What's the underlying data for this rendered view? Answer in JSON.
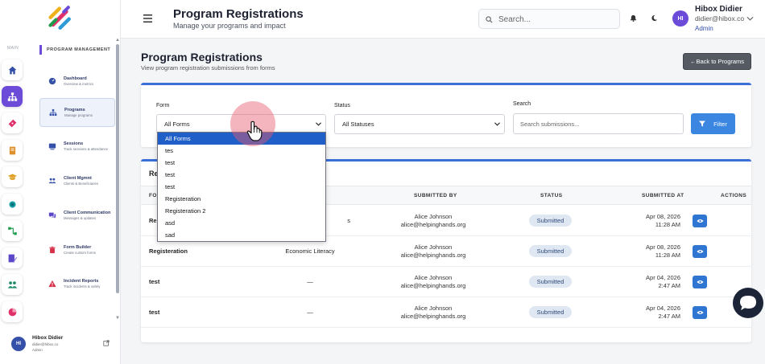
{
  "rail": {
    "main_label": "MAIN",
    "items": [
      {
        "icon": "home-icon",
        "color": "#3450a8"
      },
      {
        "icon": "hierarchy-icon",
        "color": "#ffffff",
        "active": true
      },
      {
        "icon": "ticket-icon",
        "color": "#e0306a"
      },
      {
        "icon": "book-icon",
        "color": "#e0902a"
      },
      {
        "icon": "graduation-cap-icon",
        "color": "#e0a22a"
      },
      {
        "icon": "circle-icon",
        "color": "#16a0a8"
      },
      {
        "icon": "flow-icon",
        "color": "#1a9a4a"
      },
      {
        "icon": "form-edit-icon",
        "color": "#5a48c8"
      },
      {
        "icon": "people-icon",
        "color": "#1f8a6a"
      },
      {
        "icon": "pie-chart-icon",
        "color": "#e0306a"
      }
    ]
  },
  "sidebar": {
    "section_title": "PROGRAM MANAGEMENT",
    "items": [
      {
        "label": "Dashboard",
        "desc": "Overview & metrics",
        "icon": "gauge-icon"
      },
      {
        "label": "Programs",
        "desc": "Manage programs",
        "icon": "hierarchy-icon",
        "active": true
      },
      {
        "label": "Sessions",
        "desc": "Track sessions & attendance",
        "icon": "sessions-icon"
      },
      {
        "label": "Client Mgmnt",
        "desc": "Clients & Beneficiaries",
        "icon": "people-icon"
      },
      {
        "label": "Client Communication",
        "desc": "Messages & updates",
        "icon": "chat-icon"
      },
      {
        "label": "Form Builder",
        "desc": "Create custom forms",
        "icon": "trash-icon"
      },
      {
        "label": "Incident Reports",
        "desc": "Track incidents & safety",
        "icon": "warning-icon"
      }
    ],
    "user": {
      "initials": "HI",
      "name": "Hibox Didier",
      "email": "didier@hibox.co",
      "role": "Admin"
    }
  },
  "header": {
    "title": "Program Registrations",
    "subtitle": "Manage your programs and impact",
    "search_placeholder": "Search...",
    "user": {
      "initials": "HI",
      "name": "Hibox Didier",
      "email": "didier@hibox.co",
      "role": "Admin"
    }
  },
  "page": {
    "title": "Program Registrations",
    "subtitle": "View program registration submissions from forms",
    "back_label": "←Back to Programs"
  },
  "filters": {
    "form_label": "Form",
    "form_value": "All Forms",
    "status_label": "Status",
    "status_value": "All Statuses",
    "search_label": "Search",
    "search_placeholder": "Search submissions...",
    "filter_label": "Filter"
  },
  "dropdown": {
    "options": [
      "All Forms",
      "tes",
      "test",
      "test",
      "test",
      "Registeration",
      "Registeration 2",
      "asd",
      "sad"
    ],
    "selected_index": 0
  },
  "table": {
    "title_visible": "Re",
    "columns": [
      "FO",
      "SUBMITTED BY",
      "STATUS",
      "SUBMITTED AT",
      "ACTIONS"
    ],
    "rows": [
      {
        "form": "Re",
        "program": "s",
        "by_name": "Alice Johnson",
        "by_email": "alice@helpinghands.org",
        "status": "Submitted",
        "date": "Apr 08, 2026",
        "time": "11:28 AM"
      },
      {
        "form": "Registeration",
        "program": "Economic Literacy",
        "by_name": "Alice Johnson",
        "by_email": "alice@helpinghands.org",
        "status": "Submitted",
        "date": "Apr 08, 2026",
        "time": "11:28 AM"
      },
      {
        "form": "test",
        "program": "—",
        "by_name": "Alice Johnson",
        "by_email": "alice@helpinghands.org",
        "status": "Submitted",
        "date": "Apr 04, 2026",
        "time": "2:47 AM"
      },
      {
        "form": "test",
        "program": "—",
        "by_name": "Alice Johnson",
        "by_email": "alice@helpinghands.org",
        "status": "Submitted",
        "date": "Apr 04, 2026",
        "time": "2:47 AM"
      }
    ]
  },
  "colors": {
    "accent": "#6b4bd8",
    "primary": "#3a6fd8",
    "button_blue": "#3a86e0",
    "badge_bg": "#dfe7f2"
  }
}
